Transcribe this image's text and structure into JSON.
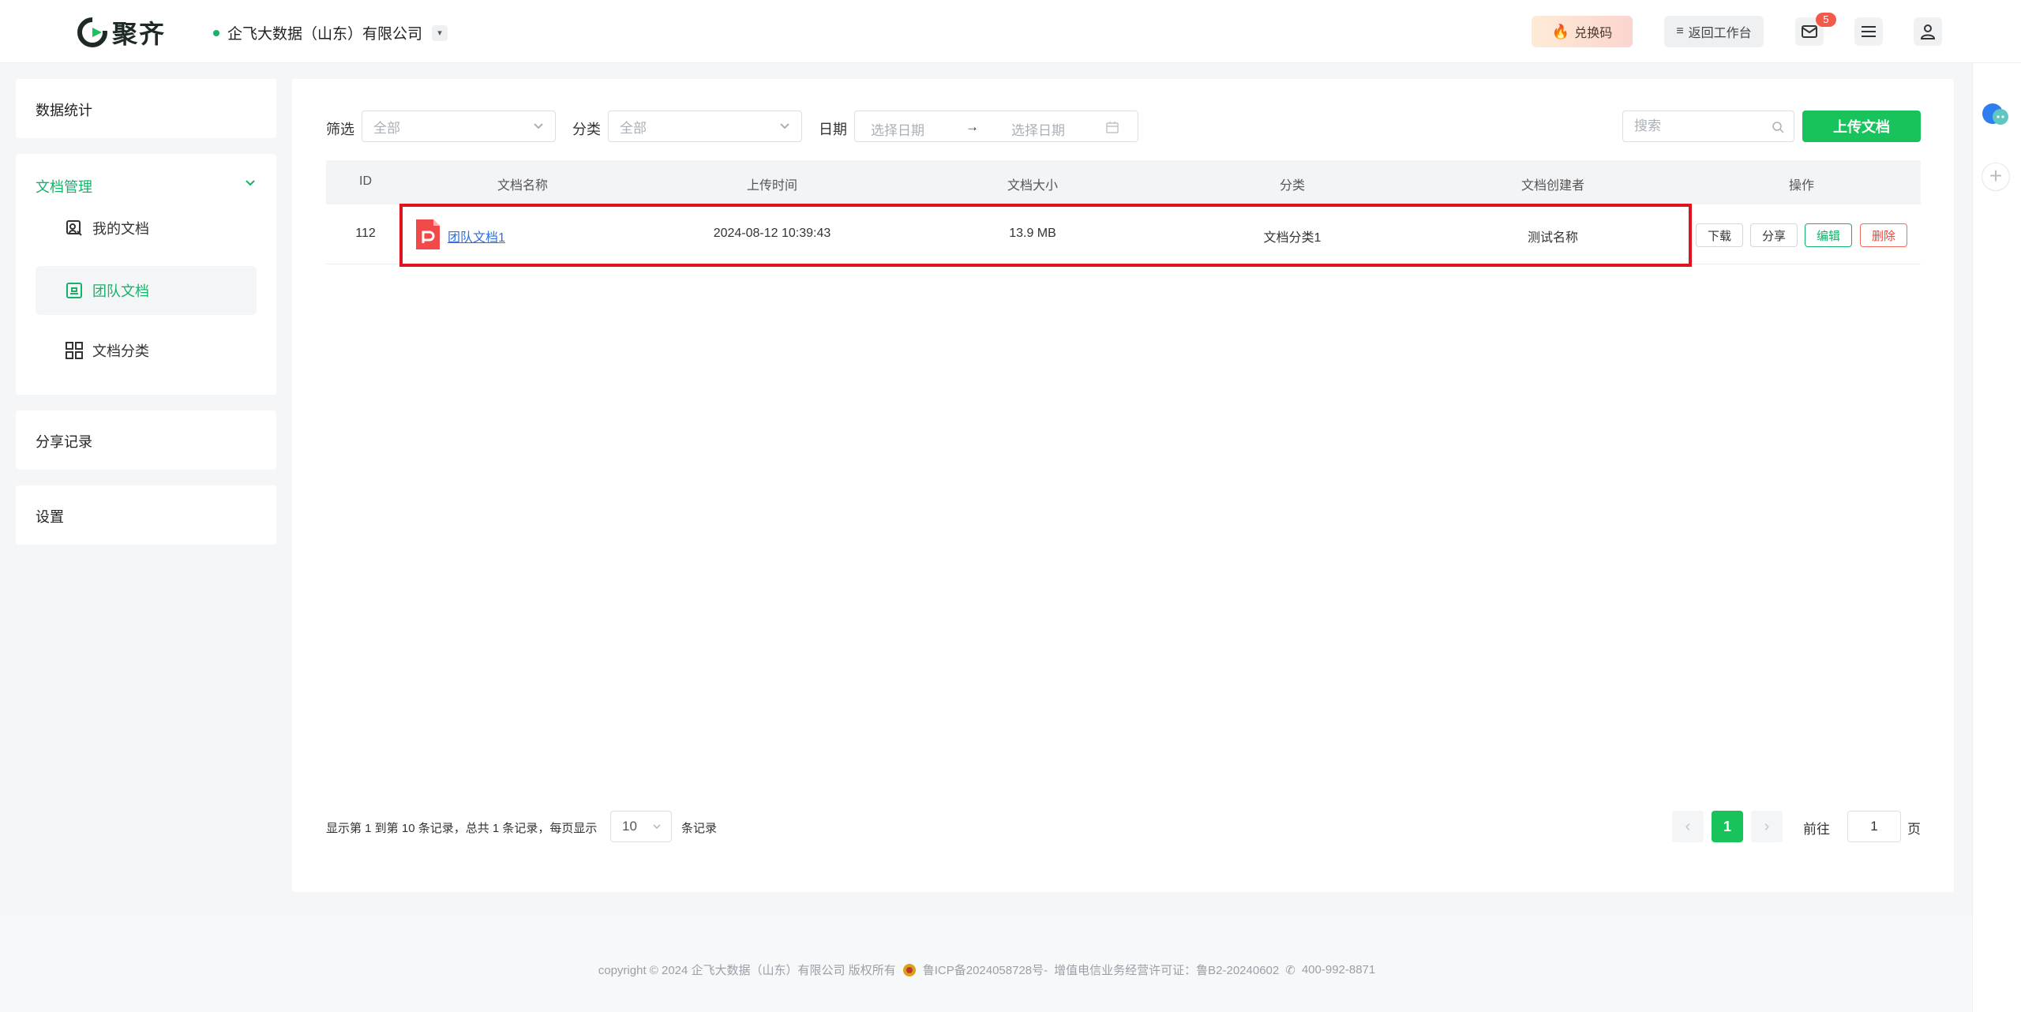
{
  "header": {
    "brand": "聚齐",
    "company": "企飞大数据（山东）有限公司",
    "redeem_label": "兑换码",
    "back_label": "返回工作台",
    "mail_count": "5",
    "icons": [
      "fire-icon",
      "list-icon",
      "mail-icon",
      "menu-icon",
      "user-icon"
    ]
  },
  "sidebar": {
    "stats": "数据统计",
    "doc_mgmt": "文档管理",
    "items": [
      {
        "label": "我的文档",
        "icon": "my-docs-icon"
      },
      {
        "label": "团队文档",
        "icon": "team-docs-icon",
        "active": true
      },
      {
        "label": "文档分类",
        "icon": "grid-icon"
      }
    ],
    "share_records": "分享记录",
    "settings": "设置"
  },
  "filters": {
    "filter_label": "筛选",
    "filter_value": "全部",
    "category_label": "分类",
    "category_value": "全部",
    "date_label": "日期",
    "date_start_placeholder": "选择日期",
    "date_arrow": "→",
    "date_end_placeholder": "选择日期",
    "search_placeholder": "搜索",
    "upload_label": "上传文档"
  },
  "table": {
    "columns": [
      "ID",
      "文档名称",
      "上传时间",
      "文档大小",
      "分类",
      "文档创建者",
      "操作"
    ],
    "rows": [
      {
        "id": "112",
        "name": "团队文档1",
        "uploaded": "2024-08-12 10:39:43",
        "size": "13.9 MB",
        "category": "文档分类1",
        "creator": "测试名称",
        "actions": [
          "下载",
          "分享",
          "编辑",
          "删除"
        ]
      }
    ]
  },
  "pagination": {
    "summary": "显示第 1 到第 10 条记录，总共 1 条记录，每页显示",
    "page_size": "10",
    "suffix": "条记录",
    "current_page": "1",
    "goto_label": "前往",
    "goto_value": "1",
    "page_unit": "页"
  },
  "footer": {
    "copyright": "copyright © 2024 企飞大数据（山东）有限公司 版权所有",
    "icp": "鲁ICP备2024058728号-",
    "license": "增值电信业务经营许可证：鲁B2-20240602",
    "phone": "400-992-8871"
  },
  "colors": {
    "accent": "#17c35a",
    "link": "#2f6fe0",
    "danger": "#e8463a",
    "highlight": "#e0141e"
  }
}
